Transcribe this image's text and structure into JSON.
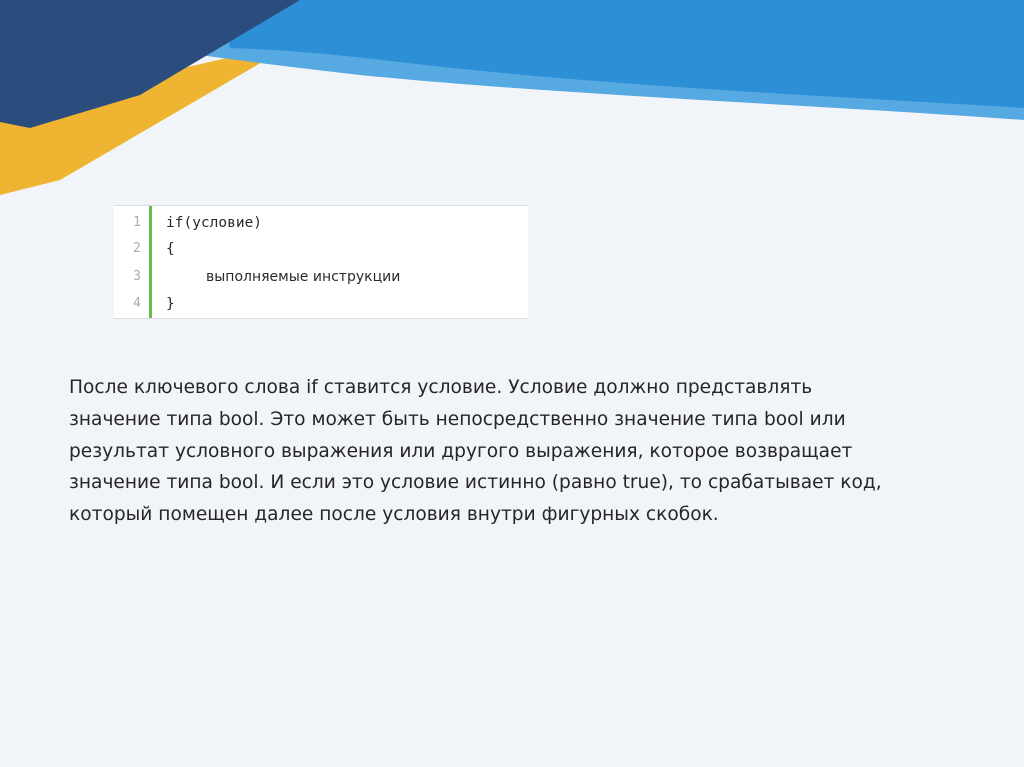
{
  "colors": {
    "background": "#f1f4f8",
    "navy": "#2b4d7e",
    "blue": "#2d8fd5",
    "gold": "#f0b433",
    "accent_green": "#6abf4b"
  },
  "code": {
    "line_numbers": [
      "1",
      "2",
      "3",
      "4"
    ],
    "lines": [
      "if(условие)",
      "{",
      "выполняемые инструкции",
      "}"
    ]
  },
  "paragraph": {
    "lines": [
      "После ключевого слова if ставится условие. Условие должно представлять",
      "значение типа bool. Это может быть непосредственно значение типа bool или",
      "результат условного выражения или другого выражения, которое возвращает",
      "значение типа bool. И если это условие истинно (равно true), то срабатывает код,",
      "который помещен далее после условия внутри фигурных скобок."
    ]
  }
}
